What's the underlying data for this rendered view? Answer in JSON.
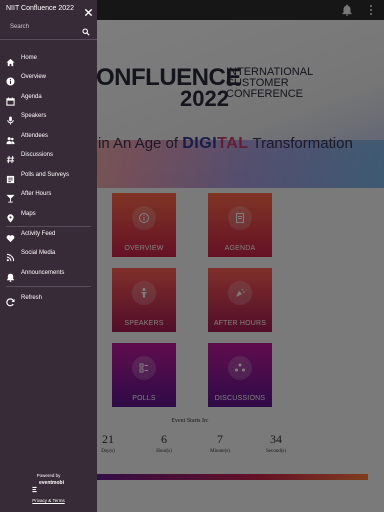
{
  "drawer": {
    "title": "NIIT Confluence 2022",
    "search_placeholder": "Search",
    "items": [
      {
        "label": "Home",
        "icon": "home-icon"
      },
      {
        "label": "Overview",
        "icon": "info-icon"
      },
      {
        "label": "Agenda",
        "icon": "calendar-icon"
      },
      {
        "label": "Speakers",
        "icon": "microphone-icon"
      },
      {
        "label": "Attendees",
        "icon": "people-icon"
      },
      {
        "label": "Discussions",
        "icon": "hashtag-icon"
      },
      {
        "label": "Polls and Surveys",
        "icon": "list-icon"
      },
      {
        "label": "After Hours",
        "icon": "cocktail-icon"
      },
      {
        "label": "Maps",
        "icon": "map-pin-icon"
      },
      {
        "label": "Activity Feed",
        "icon": "heart-icon"
      },
      {
        "label": "Social Media",
        "icon": "rss-icon"
      },
      {
        "label": "Announcements",
        "icon": "bell-icon"
      },
      {
        "label": "Refresh",
        "icon": "refresh-icon"
      }
    ],
    "powered_by": "Powered by",
    "brand": "eventmobi",
    "privacy": "Privacy & Terms"
  },
  "banner": {
    "conf_word": "ONFLUENCE",
    "conf_year": "2022",
    "conf_subtitle_lines": [
      "INTERNATIONAL",
      "CUSTOMER",
      "CONFERENCE"
    ],
    "tagline_pre": "in An Age of",
    "tagline_digital_a": "DIGI",
    "tagline_digital_b": "TAL",
    "tagline_post": "Transformation"
  },
  "tiles": [
    {
      "label": "OVERVIEW"
    },
    {
      "label": "AGENDA"
    },
    {
      "label": "SPEAKERS"
    },
    {
      "label": "AFTER HOURS"
    },
    {
      "label": "POLLS"
    },
    {
      "label": "DISCUSSIONS"
    }
  ],
  "countdown": {
    "title": "Event Starts In:",
    "days": "21",
    "days_unit": "Day(s)",
    "hours": "6",
    "hours_unit": "Hour(s)",
    "minutes": "7",
    "minutes_unit": "Minute(s)",
    "seconds": "34",
    "seconds_unit": "Second(s)"
  },
  "colors": {
    "drawer_bg": "#372b37",
    "accent_red": "#c9224b",
    "accent_purple": "#5d1790"
  }
}
